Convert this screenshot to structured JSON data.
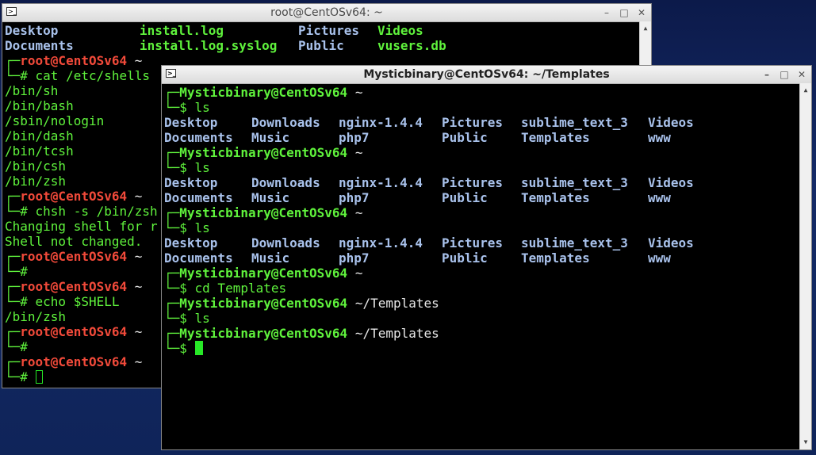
{
  "back_window": {
    "title": "root@CentOSv64: ~",
    "lines": [
      {
        "type": "ls",
        "cols": [
          "Desktop",
          "install.log",
          "Pictures",
          "Videos"
        ]
      },
      {
        "type": "ls",
        "cols": [
          "Documents",
          "install.log.syslog",
          "Public",
          "vusers.db"
        ]
      },
      {
        "type": "prompt",
        "user": "root@CentOSv64",
        "path": "~",
        "cmd": ""
      },
      {
        "type": "cmd",
        "cmd": "cat /etc/shells"
      },
      {
        "type": "out",
        "text": "/bin/sh"
      },
      {
        "type": "out",
        "text": "/bin/bash"
      },
      {
        "type": "out",
        "text": "/sbin/nologin"
      },
      {
        "type": "out",
        "text": "/bin/dash"
      },
      {
        "type": "out",
        "text": "/bin/tcsh"
      },
      {
        "type": "out",
        "text": "/bin/csh"
      },
      {
        "type": "out",
        "text": "/bin/zsh"
      },
      {
        "type": "prompt",
        "user": "root@CentOSv64",
        "path": "~",
        "cmd": ""
      },
      {
        "type": "cmd",
        "cmd": "chsh -s /bin/zsh"
      },
      {
        "type": "out",
        "text": "Changing shell for r"
      },
      {
        "type": "out",
        "text": "Shell not changed."
      },
      {
        "type": "prompt",
        "user": "root@CentOSv64",
        "path": "~",
        "cmd": ""
      },
      {
        "type": "cmd",
        "cmd": ""
      },
      {
        "type": "prompt",
        "user": "root@CentOSv64",
        "path": "~",
        "cmd": ""
      },
      {
        "type": "cmd",
        "cmd": "echo $SHELL"
      },
      {
        "type": "out",
        "text": "/bin/zsh"
      },
      {
        "type": "prompt",
        "user": "root@CentOSv64",
        "path": "~",
        "cmd": ""
      },
      {
        "type": "cmd",
        "cmd": ""
      },
      {
        "type": "prompt",
        "user": "root@CentOSv64",
        "path": "~",
        "cmd": ""
      },
      {
        "type": "cursor",
        "cmd": ""
      }
    ]
  },
  "front_window": {
    "title": "Mysticbinary@CentOSv64: ~/Templates",
    "lines": [
      {
        "type": "prompt",
        "user": "Mysticbinary@CentOSv64",
        "path": "~"
      },
      {
        "type": "cmd",
        "cmd": "ls"
      },
      {
        "type": "ls",
        "cols": [
          "Desktop",
          "Downloads",
          "nginx-1.4.4",
          "Pictures",
          "sublime_text_3",
          "Videos"
        ]
      },
      {
        "type": "ls",
        "cols": [
          "Documents",
          "Music",
          "php7",
          "Public",
          "Templates",
          "www"
        ]
      },
      {
        "type": "prompt",
        "user": "Mysticbinary@CentOSv64",
        "path": "~"
      },
      {
        "type": "cmd",
        "cmd": "ls"
      },
      {
        "type": "ls",
        "cols": [
          "Desktop",
          "Downloads",
          "nginx-1.4.4",
          "Pictures",
          "sublime_text_3",
          "Videos"
        ]
      },
      {
        "type": "ls",
        "cols": [
          "Documents",
          "Music",
          "php7",
          "Public",
          "Templates",
          "www"
        ]
      },
      {
        "type": "prompt",
        "user": "Mysticbinary@CentOSv64",
        "path": "~"
      },
      {
        "type": "cmd",
        "cmd": "ls"
      },
      {
        "type": "ls",
        "cols": [
          "Desktop",
          "Downloads",
          "nginx-1.4.4",
          "Pictures",
          "sublime_text_3",
          "Videos"
        ]
      },
      {
        "type": "ls",
        "cols": [
          "Documents",
          "Music",
          "php7",
          "Public",
          "Templates",
          "www"
        ]
      },
      {
        "type": "prompt",
        "user": "Mysticbinary@CentOSv64",
        "path": "~"
      },
      {
        "type": "cmd",
        "cmd": "cd Templates"
      },
      {
        "type": "prompt",
        "user": "Mysticbinary@CentOSv64",
        "path": "~/Templates"
      },
      {
        "type": "cmd",
        "cmd": "ls"
      },
      {
        "type": "prompt",
        "user": "Mysticbinary@CentOSv64",
        "path": "~/Templates"
      },
      {
        "type": "cursor",
        "cmd": ""
      }
    ]
  },
  "colors": {
    "dir": "#a9c2ec",
    "file": "#5ff23c",
    "root_user": "#f24a3a",
    "user": "#5ff23c",
    "cursor": "#27e827"
  },
  "icons": {
    "terminal": "terminal-icon",
    "minimize": "minimize-icon",
    "maximize": "maximize-icon",
    "close": "close-icon"
  }
}
